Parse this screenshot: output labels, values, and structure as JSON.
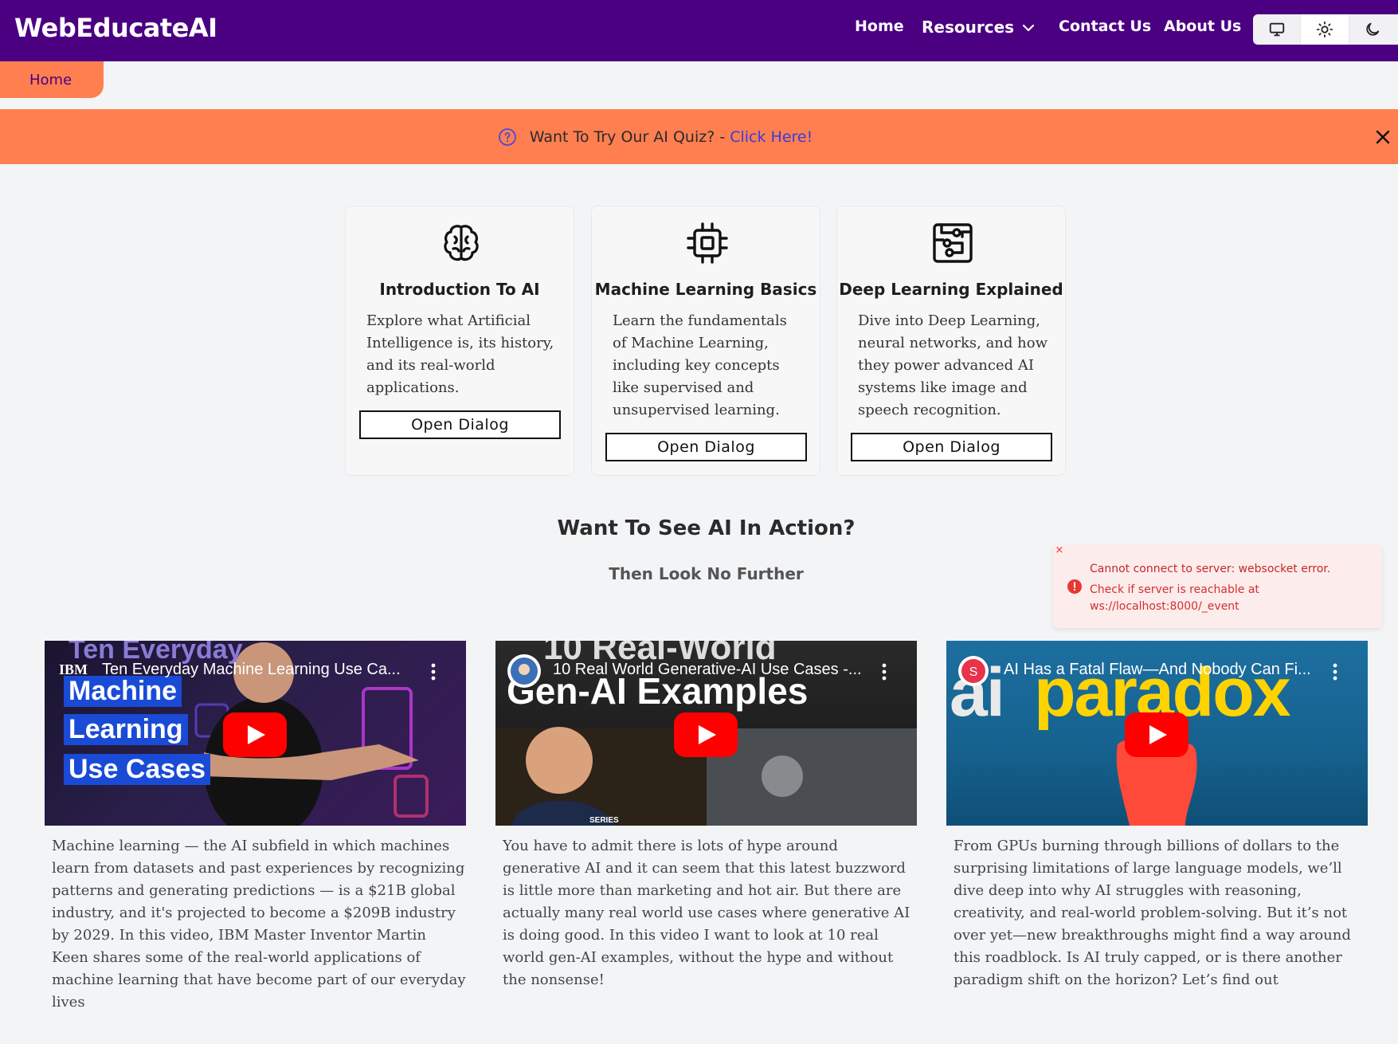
{
  "navbar": {
    "brand": "WebEducateAI",
    "links": {
      "home": "Home",
      "resources": "Resources",
      "contact": "Contact Us",
      "about": "About Us"
    },
    "theme_options": [
      "monitor-icon",
      "sun-icon",
      "moon-icon"
    ],
    "active_theme": "light",
    "background": "#4b0082"
  },
  "breadcrumb": {
    "label": "Home"
  },
  "banner": {
    "text": "Want To Try Our AI Quiz? - ",
    "link": "Click Here!",
    "background": "#ff7f50"
  },
  "cards": [
    {
      "icon": "brain-icon",
      "title": "Introduction To AI",
      "description": "Explore what Artificial Intelligence is, its history, and its real-world applications.",
      "button": "Open Dialog"
    },
    {
      "icon": "cpu-chip-icon",
      "title": "Machine Learning Basics",
      "description": "Learn the fundamentals of Machine Learning, including key concepts like supervised and unsupervised learning.",
      "button": "Open Dialog"
    },
    {
      "icon": "circuit-board-icon",
      "title": "Deep Learning Explained",
      "description": "Dive into Deep Learning, neural networks, and how they power advanced AI systems like image and speech recognition.",
      "button": "Open Dialog"
    }
  ],
  "section": {
    "title": "Want To See AI In Action?",
    "subtitle": "Then Look No Further"
  },
  "toast": {
    "title": "Cannot connect to server: websocket error.",
    "text": "Check if server is reachable at ws://localhost:8000/_event"
  },
  "videos": [
    {
      "title": "Ten Everyday Machine Learning Use Ca...",
      "channel": "IBM",
      "thumb_text": [
        "Ten Everyday",
        "Machine",
        "Learning",
        "Use Cases"
      ],
      "description": "Machine learning — the AI subfield in which machines learn from datasets and past experiences by recognizing patterns and generating predictions — is a $21B global industry, and it's projected to become a $209B industry by 2029. In this video, IBM Master Inventor Martin Keen shares some of the real-world applications of machine learning that have become part of our everyday lives"
    },
    {
      "title": "10 Real World Generative-AI Use Cases -...",
      "thumb_text": [
        "10 Real-World",
        "Gen-AI Examples",
        "SERIES"
      ],
      "description": "You have to admit there is lots of hype around generative AI and it can seem that this latest buzzword is little more than marketing and hot air. But there are actually many real world use cases where generative AI is doing good. In this video I want to look at 10 real world gen-AI examples, without the hype and without the nonsense!"
    },
    {
      "title": "AI Has a Fatal Flaw—And Nobody Can Fi...",
      "channel": "S",
      "thumb_text": [
        "ai",
        "paradox"
      ],
      "description": "From GPUs burning through billions of dollars to the surprising limitations of large language models, we’ll dive deep into why AI struggles with reasoning, creativity, and real-world problem-solving. But it’s not over yet—new breakthroughs might find a way around this roadblock. Is AI truly capped, or is there another paradigm shift on the horizon? Let’s find out"
    }
  ]
}
